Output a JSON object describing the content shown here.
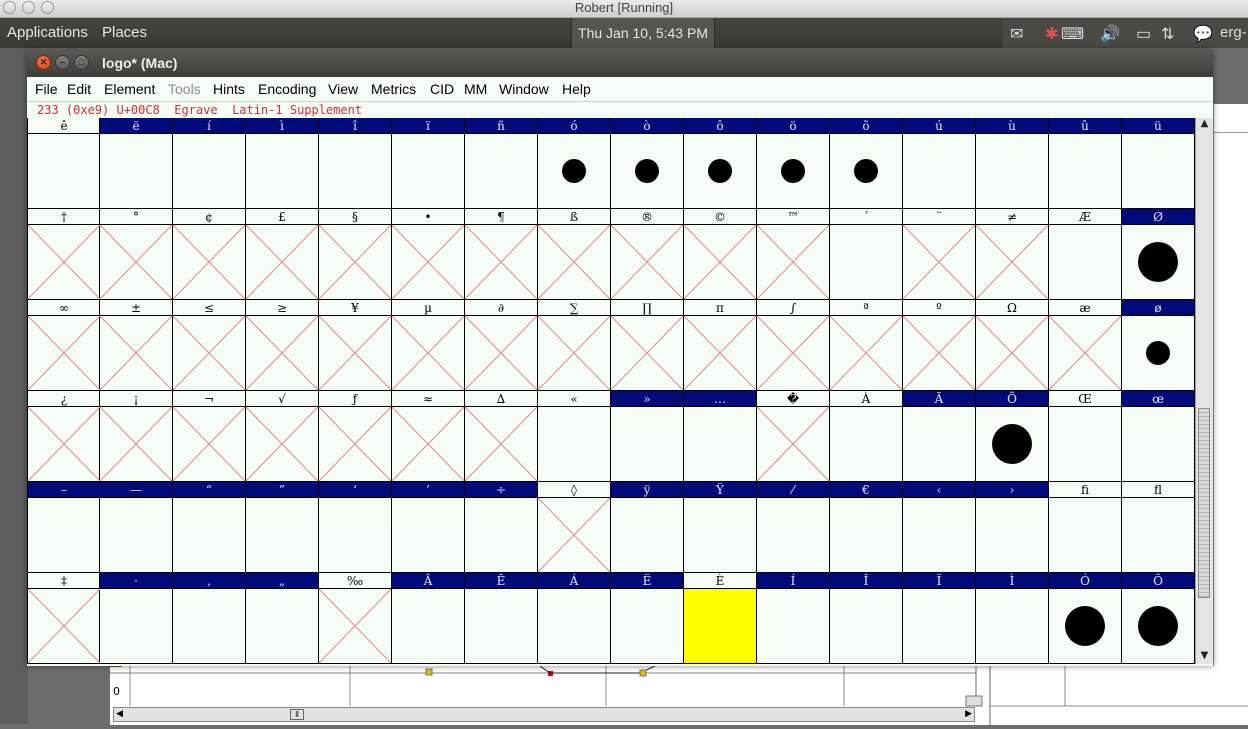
{
  "mac_titlebar": {
    "title": "Robert [Running]"
  },
  "ubuntu_panel": {
    "applications": "Applications",
    "places": "Places",
    "clock": "Thu Jan 10,  5:43 PM",
    "user": "erg-"
  },
  "window": {
    "title": "logo*  (Mac)",
    "menu": [
      "File",
      "Edit",
      "Element",
      "Tools",
      "Hints",
      "Encoding",
      "View",
      "Metrics",
      "CID",
      "MM",
      "Window",
      "Help"
    ],
    "info": "233 (0xe9) U+00C8  Egrave  Latin-1 Supplement"
  },
  "colors": {
    "selected_header": "#000a7a",
    "grid_bg": "#f5fbf5",
    "cross": "#e08a8a",
    "highlight_cell": "#ffff00"
  },
  "grid": {
    "rows": [
      {
        "labels": [
          "ê",
          "ë",
          "í",
          "ì",
          "î",
          "ï",
          "ñ",
          "ó",
          "ò",
          "ô",
          "ö",
          "õ",
          "ú",
          "ù",
          "û",
          "ü"
        ],
        "selected": [
          1,
          2,
          3,
          4,
          5,
          6,
          7,
          8,
          9,
          10,
          11,
          12,
          13,
          14,
          15
        ],
        "cross": [],
        "dots": {
          "7": "m",
          "8": "m",
          "9": "m",
          "10": "m",
          "11": "m"
        }
      },
      {
        "labels": [
          "†",
          "°",
          "¢",
          "£",
          "§",
          "•",
          "¶",
          "ß",
          "®",
          "©",
          "™",
          "´",
          "¨",
          "≠",
          "Æ",
          "Ø"
        ],
        "selected": [
          15
        ],
        "cross": [
          0,
          1,
          2,
          3,
          4,
          5,
          6,
          7,
          8,
          9,
          10,
          12,
          13
        ],
        "dots": {
          "15": "l"
        }
      },
      {
        "labels": [
          "∞",
          "±",
          "≤",
          "≥",
          "¥",
          "µ",
          "∂",
          "∑",
          "∏",
          "π",
          "∫",
          "ª",
          "º",
          "Ω",
          "æ",
          "ø"
        ],
        "selected": [
          15
        ],
        "cross": [
          0,
          1,
          2,
          3,
          4,
          5,
          6,
          7,
          8,
          9,
          10,
          11,
          12,
          13,
          14
        ],
        "dots": {
          "15": "s"
        }
      },
      {
        "labels": [
          "¿",
          "¡",
          "¬",
          "√",
          "ƒ",
          "≈",
          "∆",
          "«",
          "»",
          "…",
          "�",
          "À",
          "Ã",
          "Õ",
          "Œ",
          "œ"
        ],
        "selected": [
          8,
          9,
          12,
          13,
          15
        ],
        "cross": [
          0,
          1,
          2,
          3,
          4,
          5,
          6,
          10
        ],
        "dots": {
          "13": "l"
        }
      },
      {
        "labels": [
          "–",
          "—",
          "“",
          "”",
          "‘",
          "’",
          "÷",
          "◊",
          "ÿ",
          "Ÿ",
          "⁄",
          "€",
          "‹",
          "›",
          "ﬁ",
          "ﬂ"
        ],
        "selected": [
          0,
          1,
          2,
          3,
          4,
          5,
          6,
          8,
          9,
          10,
          11,
          12,
          13
        ],
        "cross": [
          7
        ],
        "dots": {}
      },
      {
        "labels": [
          "‡",
          "·",
          "‚",
          "„",
          "‰",
          "Â",
          "Ê",
          "Á",
          "Ë",
          "È",
          "Í",
          "Î",
          "Ï",
          "Ì",
          "Ó",
          "Ô"
        ],
        "selected": [
          1,
          2,
          3,
          5,
          6,
          7,
          8,
          10,
          11,
          12,
          13,
          14,
          15
        ],
        "cross": [
          0,
          4
        ],
        "highlight": [
          9
        ],
        "dots": {
          "14": "l",
          "15": "l"
        }
      }
    ]
  },
  "background_app": {
    "zero_label": "0"
  }
}
